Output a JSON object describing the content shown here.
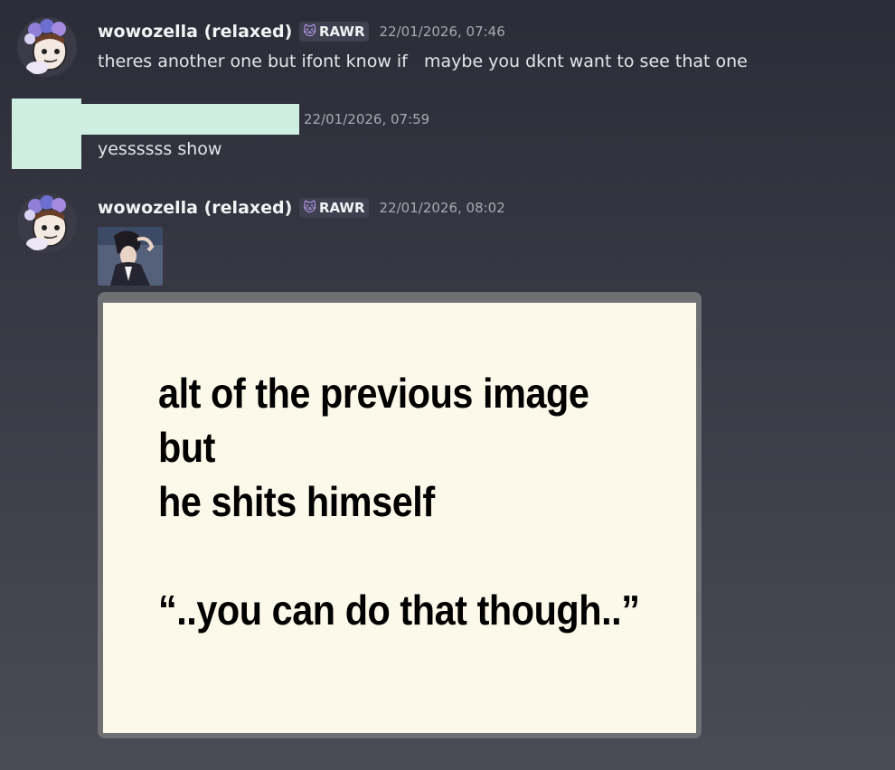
{
  "messages": [
    {
      "username": "wowozella (relaxed)",
      "tag": "RAWR",
      "timestamp": "22/01/2026, 07:46",
      "text": "theres another one but ifont know if   maybe you dknt want to see that one"
    },
    {
      "username": "",
      "timestamp": "22/01/2026, 07:59",
      "text": "yessssss show"
    },
    {
      "username": "wowozella (relaxed)",
      "tag": "RAWR",
      "timestamp": "22/01/2026, 08:02",
      "attachment_text": {
        "line1": "alt of the previous image but",
        "line2": "he shits himself",
        "line3": "“..you can do that though..”"
      }
    }
  ],
  "colors": {
    "redaction": "#cdeee1",
    "image_background": "#fdf9ea",
    "timestamp": "#a7a9b2"
  },
  "icons": {
    "tag_icon": "cat-face-icon"
  }
}
